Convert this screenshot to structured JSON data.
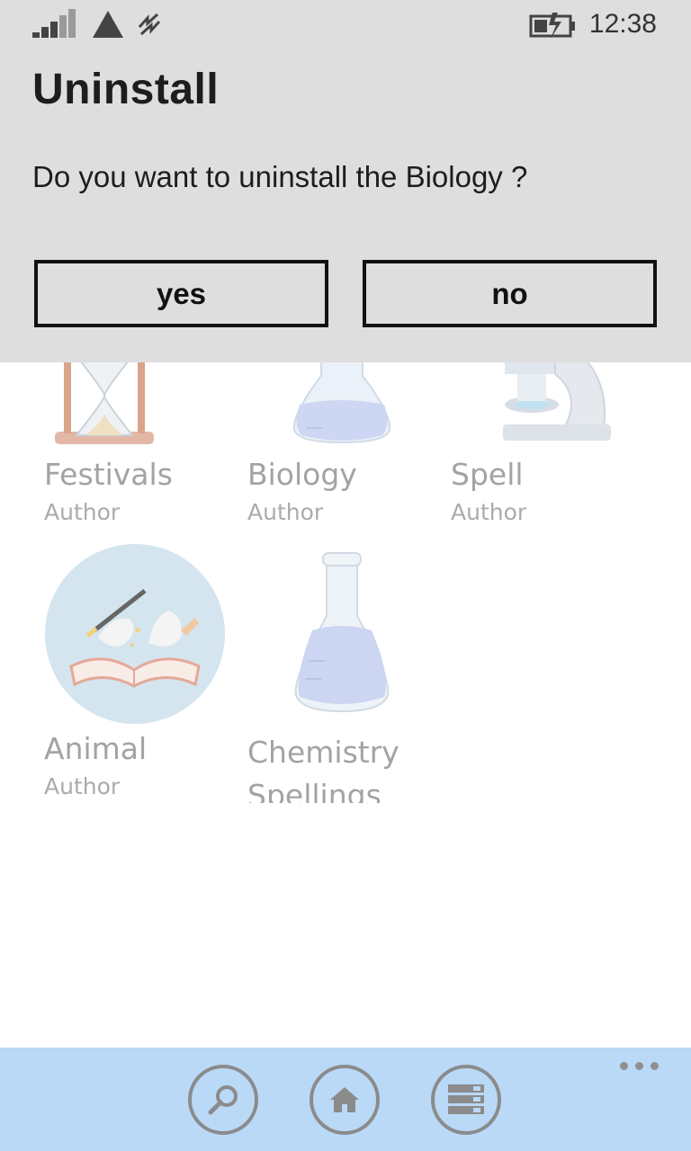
{
  "status_bar": {
    "time": "12:38",
    "icons": [
      "signal-strength-icon",
      "data-connection-icon",
      "vibrate-icon",
      "battery-charging-icon"
    ]
  },
  "dialog": {
    "title": "Uninstall",
    "message": "Do you want to uninstall the Biology ?",
    "yes_label": "yes",
    "no_label": "no"
  },
  "apps": [
    {
      "title": "Festivals",
      "subtitle": "Author",
      "icon": "hourglass-icon"
    },
    {
      "title": "Biology",
      "subtitle": "Author",
      "icon": "flask-icon"
    },
    {
      "title": "Spell",
      "subtitle": "Author",
      "icon": "microscope-icon"
    },
    {
      "title": "Animal",
      "subtitle": "Author",
      "icon": "magic-book-icon"
    },
    {
      "title": "Chemistry",
      "subtitle": "Spellings",
      "icon": "flask-icon"
    }
  ],
  "app_bar": {
    "buttons": [
      "search-icon",
      "home-icon",
      "list-icon"
    ],
    "more": "ellipsis-icon"
  },
  "colors": {
    "dialog_bg": "#dedede",
    "app_bar_bg": "#b9d9f7",
    "dim_text": "#a3a3a3"
  }
}
